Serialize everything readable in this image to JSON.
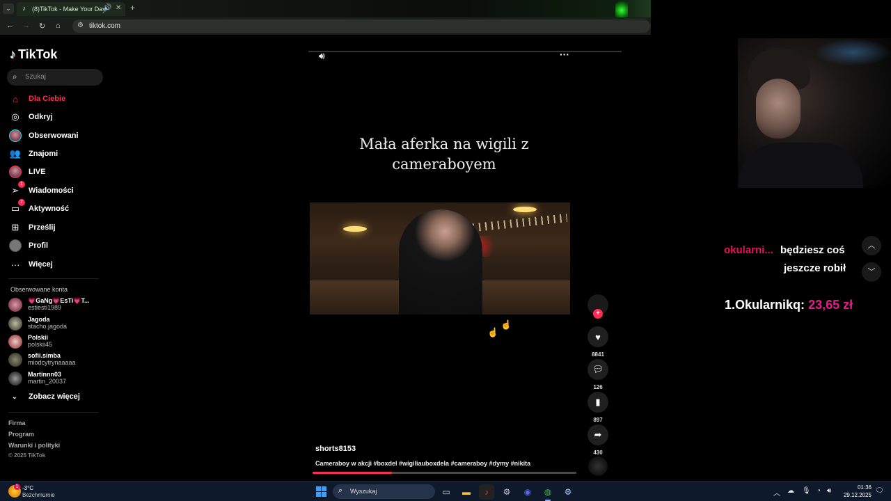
{
  "browser": {
    "tab_title": "(8)TikTok - Make Your Day",
    "url": "tiktok.com"
  },
  "sidebar": {
    "logo": "TikTok",
    "search_placeholder": "Szukaj",
    "nav": [
      {
        "label": "Dla Ciebie",
        "icon": "home-icon",
        "active": true
      },
      {
        "label": "Odkryj",
        "icon": "compass-icon"
      },
      {
        "label": "Obserwowani",
        "icon": "avatar-icon"
      },
      {
        "label": "Znajomi",
        "icon": "friends-icon"
      },
      {
        "label": "LIVE",
        "icon": "live-avatar-icon"
      },
      {
        "label": "Wiadomości",
        "icon": "send-icon",
        "badge": "1"
      },
      {
        "label": "Aktywność",
        "icon": "inbox-icon",
        "badge": "7"
      },
      {
        "label": "Prześlij",
        "icon": "upload-icon"
      },
      {
        "label": "Profil",
        "icon": "profile-avatar-icon"
      },
      {
        "label": "Więcej",
        "icon": "more-icon"
      }
    ],
    "followed_title": "Obserwowane konta",
    "accounts": [
      {
        "name": "💗GaNg💗EsTi💗T...",
        "handle": "estiesti1989"
      },
      {
        "name": "Jagoda",
        "handle": "stacho.jagoda"
      },
      {
        "name": "Polskii",
        "handle": "polskii45"
      },
      {
        "name": "sofii.simba",
        "handle": "miodcytrynaaaaa"
      },
      {
        "name": "Martinnn03",
        "handle": "martin_20037"
      }
    ],
    "see_more": "Zobacz więcej",
    "footer": [
      "Firma",
      "Program",
      "Warunki i polityki"
    ],
    "copyright": "© 2025 TikTok"
  },
  "video": {
    "overlay_title": "Mała aferka na wigili z cameraboyem",
    "author": "shorts8153",
    "caption": "Cameraboy w akcji #boxdel #wigiliauboxdela #cameraboy #dymy #nikita",
    "progress": 0.3,
    "likes": "8841",
    "comments": "126",
    "saves": "897",
    "shares": "430"
  },
  "stream_overlay": {
    "chat_user": "okularni...",
    "chat_line1": "będziesz coś",
    "chat_line2": "jeszcze robił",
    "donor_rank": "1.",
    "donor_name": "Okularnikq:",
    "donor_amount": "23,65 zł"
  },
  "taskbar": {
    "weather_temp": "-3°C",
    "weather_cond": "Bezchmurnie",
    "weather_badge": "1",
    "search_placeholder": "Wyszukaj",
    "time": "01:36",
    "date": "29.12.2025"
  },
  "colors": {
    "tiktok_red": "#fe2c55",
    "donation_pink": "#e81a8c"
  }
}
